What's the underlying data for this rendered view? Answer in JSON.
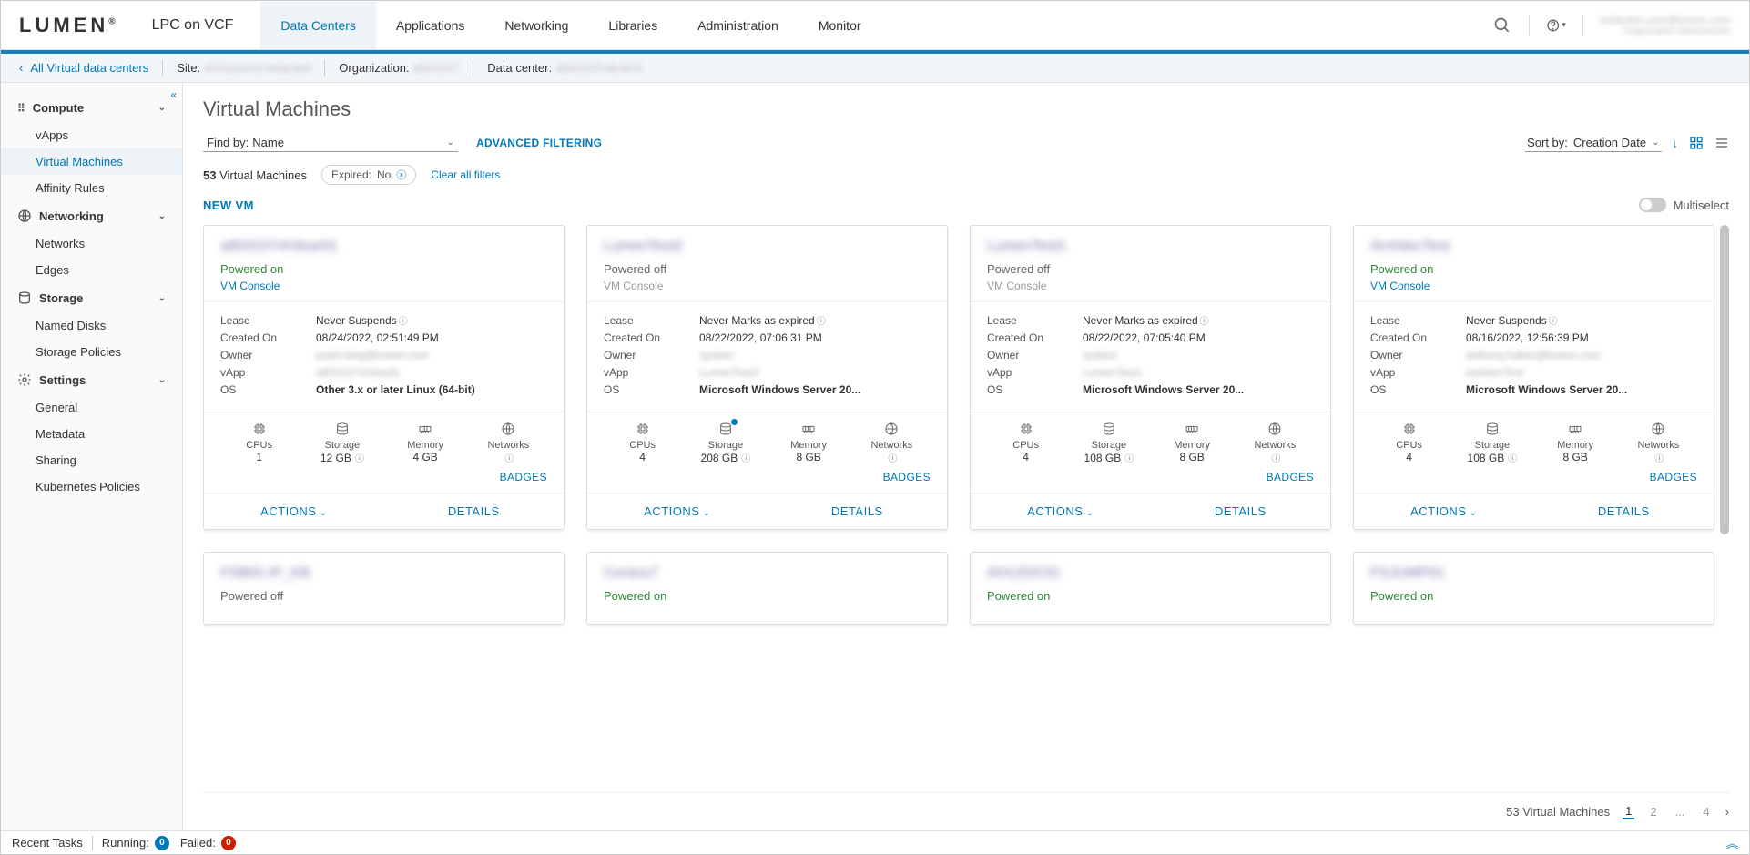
{
  "header": {
    "logo_text": "LUMEN",
    "product": "LPC on VCF",
    "tabs": [
      "Data Centers",
      "Applications",
      "Networking",
      "Libraries",
      "Administration",
      "Monitor"
    ],
    "user_name": "redacted.user@lumen.com",
    "user_role": "Organization Administrator"
  },
  "subheader": {
    "back_label": "All Virtual data centers",
    "site_label": "Site:",
    "site_value": "dc01a1vcd.redacted",
    "org_label": "Organization:",
    "org_value": "a603107",
    "dc_label": "Data center:",
    "dc_value": "a603107vdcAH1"
  },
  "sidebar": {
    "sections": [
      {
        "title": "Compute",
        "items": [
          "vApps",
          "Virtual Machines",
          "Affinity Rules"
        ]
      },
      {
        "title": "Networking",
        "items": [
          "Networks",
          "Edges"
        ]
      },
      {
        "title": "Storage",
        "items": [
          "Named Disks",
          "Storage Policies"
        ]
      },
      {
        "title": "Settings",
        "items": [
          "General",
          "Metadata",
          "Sharing",
          "Kubernetes Policies"
        ]
      }
    ]
  },
  "page": {
    "title": "Virtual Machines",
    "findby_label": "Find by:",
    "findby_value": "Name",
    "advanced_filter": "ADVANCED FILTERING",
    "sortby_label": "Sort by:",
    "sortby_value": "Creation Date",
    "count_number": "53",
    "count_label": "Virtual Machines",
    "filter_chip_label": "Expired:",
    "filter_chip_value": "No",
    "clear_filters": "Clear all filters",
    "new_vm": "NEW VM",
    "multiselect": "Multiselect"
  },
  "card_labels": {
    "lease": "Lease",
    "created": "Created On",
    "owner": "Owner",
    "vapp": "vApp",
    "os": "OS",
    "cpus": "CPUs",
    "storage": "Storage",
    "memory": "Memory",
    "networks": "Networks",
    "badges": "BADGES",
    "actions": "ACTIONS",
    "details": "DETAILS",
    "vm_console": "VM Console"
  },
  "cards": [
    {
      "title": "a603107vh3ear01",
      "status": "Powered on",
      "status_class": "on",
      "console_link": true,
      "lease": "Never Suspends",
      "created": "08/24/2022, 02:51:49 PM",
      "owner": "justin.king@lumen.com",
      "vapp": "a603107vh3exd1",
      "os": "Other 3.x or later Linux (64-bit)",
      "cpus": "1",
      "storage": "12 GB",
      "memory": "4 GB",
      "net": "",
      "storage_dot": false
    },
    {
      "title": "LumenTest2",
      "status": "Powered off",
      "status_class": "off",
      "console_link": false,
      "lease": "Never Marks as expired",
      "created": "08/22/2022, 07:06:31 PM",
      "owner": "system",
      "vapp": "LumenTest2",
      "os": "Microsoft Windows Server 20...",
      "cpus": "4",
      "storage": "208 GB",
      "memory": "8 GB",
      "net": "",
      "storage_dot": true
    },
    {
      "title": "LumenTest1",
      "status": "Powered off",
      "status_class": "off",
      "console_link": false,
      "lease": "Never Marks as expired",
      "created": "08/22/2022, 07:05:40 PM",
      "owner": "system",
      "vapp": "LumenTest1",
      "os": "Microsoft Windows Server 20...",
      "cpus": "4",
      "storage": "108 GB",
      "memory": "8 GB",
      "net": "",
      "storage_dot": false
    },
    {
      "title": "ArchitecTest",
      "status": "Powered on",
      "status_class": "on",
      "console_link": true,
      "lease": "Never Suspends",
      "created": "08/16/2022, 12:56:39 PM",
      "owner": "anthony.hakim@lumen.com",
      "vapp": "tuvhitecTest",
      "os": "Microsoft Windows Server 20...",
      "cpus": "4",
      "storage": "108 GB",
      "memory": "8 GB",
      "net": "",
      "storage_dot": false
    }
  ],
  "cards_row2": [
    {
      "title": "FSBIG-IP_KB",
      "status": "Powered off",
      "status_class": "off"
    },
    {
      "title": "Centos7",
      "status": "Powered on",
      "status_class": "on"
    },
    {
      "title": "AH12DC01",
      "status": "Powered on",
      "status_class": "on"
    },
    {
      "title": "FSJUMP01",
      "status": "Powered on",
      "status_class": "on"
    }
  ],
  "pagination": {
    "label": "53 Virtual Machines",
    "pages": [
      "1",
      "2",
      "...",
      "4"
    ]
  },
  "footer": {
    "recent": "Recent Tasks",
    "running_label": "Running:",
    "running": "0",
    "failed_label": "Failed:",
    "failed": "0"
  }
}
